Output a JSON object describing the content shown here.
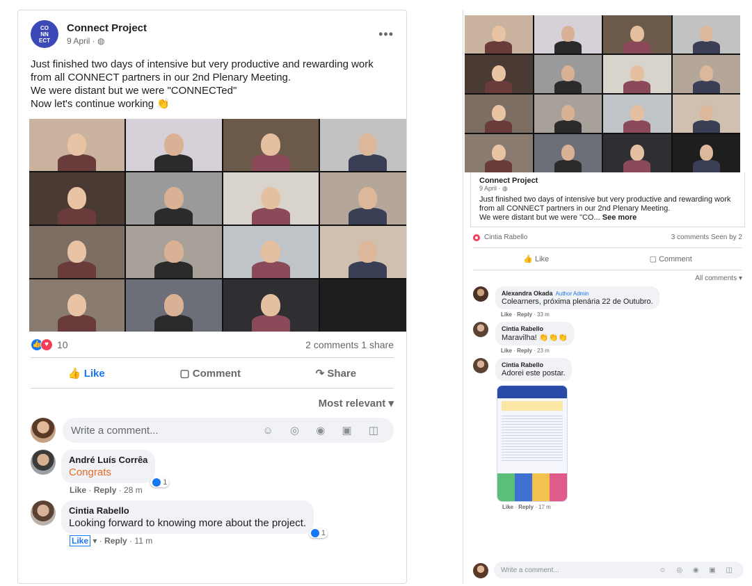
{
  "left": {
    "page_name": "Connect Project",
    "date": "9 April · ",
    "globe": "🌐",
    "more": "•••",
    "brand_logo_text": "CO\nNN\nECT",
    "text_lines": [
      "Just finished two days of intensive but very productive and rewarding work from all CONNECT partners in our 2nd Plenary Meeting.",
      "We were distant but we were \"CONNECTed\"",
      "Now let's continue working 👏"
    ],
    "reactions_count": "10",
    "comments_shares": "2 comments  1 share",
    "actions": {
      "like": "Like",
      "comment": "Comment",
      "share": "Share"
    },
    "sort": "Most relevant ▾",
    "comment_placeholder": "Write a comment...",
    "comment_icons": "☺ ◎ ◉ ▣ ◫",
    "comments": [
      {
        "name": "André Luís Corrêa",
        "text": "Congrats",
        "like": "Like",
        "reply": "Reply",
        "time": "· 28 m",
        "badge": "1"
      },
      {
        "name": "Cintia Rabello",
        "text": "Looking forward to knowing more about the project.",
        "like": "Like",
        "reply": "Reply",
        "time": "· 11 m",
        "badge": "1"
      }
    ]
  },
  "right": {
    "page_name": "Connect Project",
    "date": "9 April · ",
    "text": "Just finished two days of intensive but very productive and rewarding work from all CONNECT partners in our 2nd Plenary Meeting.",
    "text2": "We were distant but we were \"CO...",
    "see_more": "See more",
    "reactor": "Cintia Rabello",
    "stats": "3 comments  Seen by 2",
    "actions": {
      "like": "Like",
      "comment": "Comment"
    },
    "all_comments": "All comments ▾",
    "comments": [
      {
        "name": "Alexandra Okada",
        "tags": "Author  Admin",
        "text": "Colearners, próxima plenária 22 de Outubro.",
        "like": "Like",
        "reply": "Reply",
        "time": "33 m"
      },
      {
        "name": "Cintia Rabello",
        "tags": "",
        "text": "Maravilha! 👏👏👏",
        "like": "Like",
        "reply": "Reply",
        "time": "23 m"
      },
      {
        "name": "Cintia Rabello",
        "tags": "",
        "text": "Adorei este postar.",
        "like": "Like",
        "reply": "Reply",
        "time": "17 m"
      }
    ],
    "comment_placeholder": "Write a comment...",
    "comment_icons": "☺ ◎ ◉ ▣ ◫"
  },
  "colors": {
    "fb_blue": "#1877f2",
    "brand": "#3b49b6",
    "love": "#f33e58",
    "congrats": "#e46a28"
  }
}
